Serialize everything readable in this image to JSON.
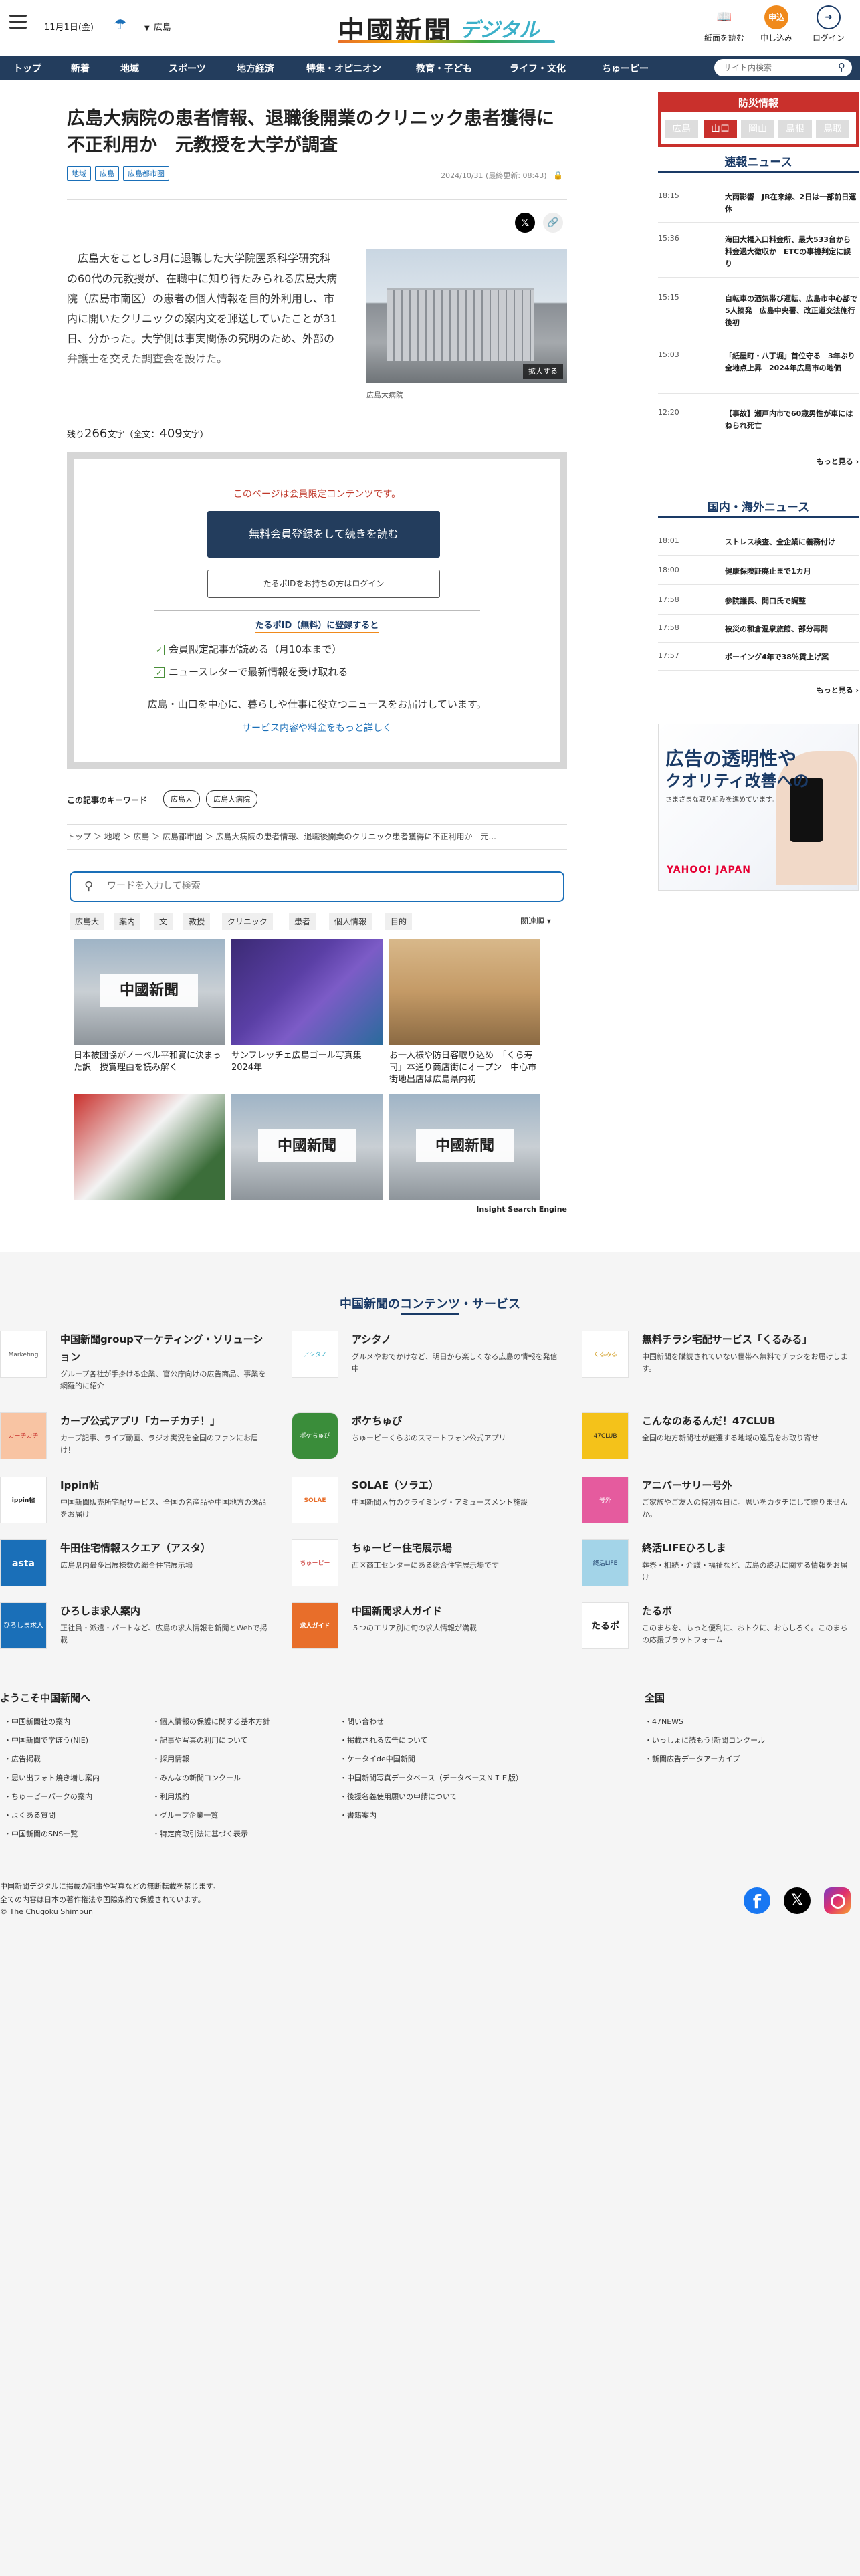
{
  "header": {
    "date": "11月1日(金)",
    "weather_icon": "umbrella-icon",
    "region": "広島",
    "logo_main": "中國新聞",
    "logo_sub": "デジタル",
    "icons": [
      {
        "label": "紙面を読む",
        "icon": "newspaper-icon"
      },
      {
        "label": "申し込み",
        "icon": "subscribe-icon",
        "badge": "申込"
      },
      {
        "label": "ログイン",
        "icon": "login-icon"
      }
    ]
  },
  "nav": {
    "items": [
      "トップ",
      "新着",
      "地域",
      "スポーツ",
      "地方経済",
      "特集・オピニオン",
      "教育・子ども",
      "ライフ・文化",
      "ちゅーピー"
    ],
    "search_placeholder": "サイト内検索"
  },
  "article": {
    "title": "広島大病院の患者情報、退職後開業のクリニック患者獲得に不正利用か　元教授を大学が調査",
    "tags": [
      "地域",
      "広島",
      "広島都市圏"
    ],
    "published": "2024/10/31",
    "updated": "(最終更新: 08:43)",
    "body": "広島大をことし3月に退職した大学院医系科学研究科の60代の元教授が、在職中に知り得たみられる広島大病院（広島市南区）の患者の個人情報を目的外利用し、市内に開いたクリニックの案内文を郵送していたことが31日、分かった。大学側は事実関係の究明のため、外部の弁護士を交えた調査会を設けた。",
    "photo_enlarge": "拡大する",
    "photo_caption": "広島大病院",
    "remain_label": "残り",
    "remain_count": "266",
    "remain_unit": "文字",
    "total_label": "（全文：",
    "total_count": "409",
    "total_unit": "文字）"
  },
  "paywall": {
    "notice": "このページは会員限定コンテンツです。",
    "register_button": "無料会員登録をして続きを読む",
    "login_button": "たるポIDをお持ちの方はログイン",
    "tarobo_heading": "たるポID（無料）に登録すると",
    "benefits": [
      "会員限定記事が読める（月10本まで）",
      "ニュースレターで最新情報を受け取れる"
    ],
    "description": "広島・山口を中心に、暮らしや仕事に役立つニュースをお届けしています。",
    "more_link": "サービス内容や料金をもっと詳しく"
  },
  "keywords": {
    "label": "この記事のキーワード",
    "items": [
      "広島大",
      "広島大病院"
    ]
  },
  "breadcrumb": "トップ ＞ 地域 ＞ 広島 ＞ 広島都市圏 ＞ 広島大病院の患者情報、退職後開業のクリニック患者獲得に不正利用か　元...",
  "insight": {
    "placeholder": "ワードを入力して検索",
    "chips": [
      "広島大",
      "案内",
      "文",
      "教授",
      "クリニック",
      "患者",
      "個人情報",
      "目的"
    ],
    "sort": "関連順",
    "cards": [
      {
        "caption": "日本被団協がノーベル平和賞に決まった訳　授賞理由を読み解く",
        "plate": "中國新聞"
      },
      {
        "caption": "サンフレッチェ広島ゴール写真集2024年",
        "plate": ""
      },
      {
        "caption": "お一人様や防日客取り込め　「くら寿司」本通り商店街にオープン　中心市街地出店は広島県内初",
        "plate": ""
      },
      {
        "caption": "",
        "plate": ""
      },
      {
        "caption": "",
        "plate": "中國新聞"
      },
      {
        "caption": "",
        "plate": "中國新聞"
      }
    ],
    "engine": "Insight Search Engine"
  },
  "sidebar": {
    "bousai_title": "防災情報",
    "bousai_tabs": [
      "広島",
      "山口",
      "岡山",
      "島根",
      "鳥取"
    ],
    "breaking_title": "速報ニュース",
    "breaking": [
      {
        "time": "18:15",
        "headline": "大雨影響　JR在来線、2日は一部前日運休"
      },
      {
        "time": "15:36",
        "headline": "海田大橋入口料金所、最大533台から料金過大徴収か　ETCの事機判定に誤り"
      },
      {
        "time": "15:15",
        "headline": "自転車の酒気帯び運転、広島市中心部で5人摘発　広島中央署、改正道交法施行後初"
      },
      {
        "time": "15:03",
        "headline": "「紙屋町・八丁堀」首位守る　3年ぶり全地点上昇　2024年広島市の地価"
      },
      {
        "time": "12:20",
        "headline": "【事故】瀬戸内市で60歳男性が車にはねられ死亡"
      }
    ],
    "breaking_more": "もっと見る ›",
    "domestic_title": "国内・海外ニュース",
    "domestic": [
      {
        "time": "18:01",
        "headline": "ストレス検査、全企業に義務付け"
      },
      {
        "time": "18:00",
        "headline": "健康保険証廃止まで1カ月"
      },
      {
        "time": "17:58",
        "headline": "参院議長、開口氏で調整"
      },
      {
        "time": "17:58",
        "headline": "被災の和倉温泉旅館、部分再開"
      },
      {
        "time": "17:57",
        "headline": "ボーイング4年で38％賃上げ案"
      }
    ],
    "domestic_more": "もっと見る ›",
    "ad": {
      "line1": "広告の透明性や",
      "line2": "クオリティ改善への",
      "line3": "さまざまな取り組みを進めています。",
      "brand": "YAHOO! JAPAN"
    }
  },
  "footer": {
    "services_title": "中国新聞のコンテンツ・サービス",
    "services": [
      {
        "name": "中国新聞groupマーケティング・ソリューション",
        "desc": "グループ各社が手掛ける企業、官公庁向けの広告商品、事業を網羅的に紹介",
        "logo": "Marketing Solution"
      },
      {
        "name": "アシタノ",
        "desc": "グルメやおでかけなど、明日から楽しくなる広島の情報を発信中",
        "logo": "アシタノ"
      },
      {
        "name": "無料チラシ宅配サービス「くるみる」",
        "desc": "中国新聞を購読されていない世帯へ無料でチラシをお届けします。",
        "logo": "くるみる"
      },
      {
        "name": "カープ公式アプリ「カーチカチ！」",
        "desc": "カープ記事、ライブ動画、ラジオ実況を全国のファンにお届け！",
        "logo": "カーチカチ"
      },
      {
        "name": "ポケちゅぴ",
        "desc": "ちゅーピーくらぶのスマートフォン公式アプリ",
        "logo": "ポケちゅぴ"
      },
      {
        "name": "こんなのあるんだ！47CLUB",
        "desc": "全国の地方新聞社が厳選する地域の逸品をお取り寄せ",
        "logo": "47CLUB"
      },
      {
        "name": "Ippin帖",
        "desc": "中国新聞販売所宅配サービス、全国の名産品や中国地方の逸品をお届け",
        "logo": "ippin帖"
      },
      {
        "name": "SOLAE（ソラエ）",
        "desc": "中国新聞大竹のクライミング・アミューズメント施設",
        "logo": "SOLAE"
      },
      {
        "name": "アニバーサリー号外",
        "desc": "ご家族やご友人の特別な日に。思いをカタチにして贈りませんか。",
        "logo": "号外"
      },
      {
        "name": "牛田住宅情報スクエア（アスタ）",
        "desc": "広島県内最多出展棟数の総合住宅展示場",
        "logo": "asta"
      },
      {
        "name": "ちゅーピー住宅展示場",
        "desc": "西区商工センターにある総合住宅展示場です",
        "logo": "ちゅーピー"
      },
      {
        "name": "終活LIFEひろしま",
        "desc": "葬祭・相続・介護・福祉など、広島の終活に関する情報をお届け",
        "logo": "終活LIFE"
      },
      {
        "name": "ひろしま求人案内",
        "desc": "正社員・派遣・パートなど、広島の求人情報を新聞とWebで掲載",
        "logo": "ひろしま求人案内"
      },
      {
        "name": "中国新聞求人ガイド",
        "desc": "５つのエリア別に旬の求人情報が満載",
        "logo": "求人ガイド"
      },
      {
        "name": "たるポ",
        "desc": "このまちを、もっと便利に、おトクに、おもしろく。このまちの応援プラットフォーム",
        "logo": "たるポ"
      }
    ],
    "welcome_title": "ようこそ中国新聞へ",
    "zenkoku_title": "全国",
    "links_col1": [
      "中国新聞社の案内",
      "中国新聞で学ぼう(NIE)",
      "広告掲載",
      "思い出フォト焼き増し案内",
      "ちゅーピーパークの案内",
      "よくある質問",
      "中国新聞のSNS一覧"
    ],
    "links_col2": [
      "個人情報の保護に関する基本方針",
      "記事や写真の利用について",
      "採用情報",
      "みんなの新聞コンクール",
      "利用規約",
      "グループ企業一覧",
      "特定商取引法に基づく表示"
    ],
    "links_col3": [
      "問い合わせ",
      "掲載される広告について",
      "ケータイde中国新聞",
      "中国新聞写真データベース（データベースＮＩＥ版）",
      "後援名義使用願いの申請について",
      "書籍案内"
    ],
    "links_col4": [
      "47NEWS",
      "いっしょに読もう!新聞コンクール",
      "新聞広告データアーカイブ"
    ],
    "copyright_line1": "中国新聞デジタルに掲載の記事や写真などの無断転載を禁じます。",
    "copyright_line2": "全ての内容は日本の著作権法や国際条約で保護されています。",
    "copyright_line3": "© The Chugoku Shimbun",
    "social": [
      "facebook-icon",
      "x-icon",
      "instagram-icon"
    ]
  }
}
